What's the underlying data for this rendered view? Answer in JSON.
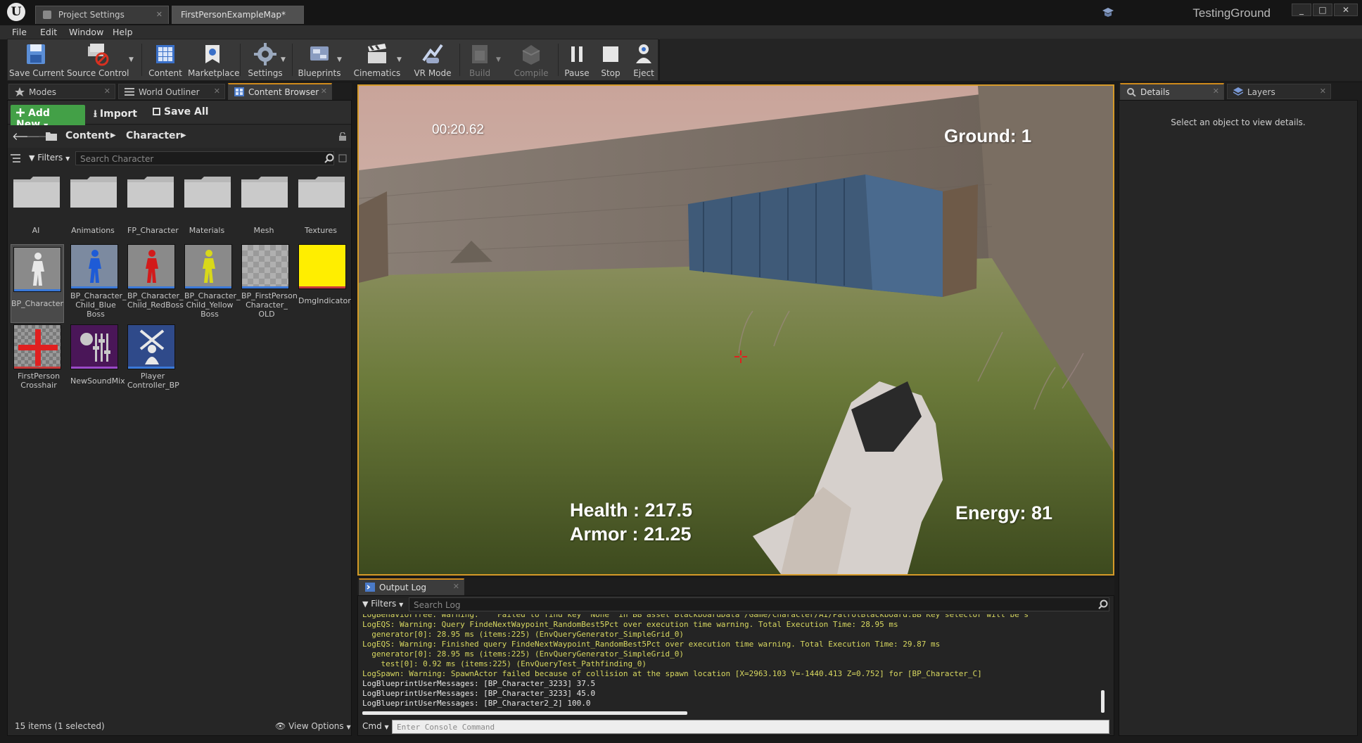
{
  "titlebar": {
    "tabs": [
      {
        "label": "Project Settings"
      },
      {
        "label": "FirstPersonExampleMap*"
      }
    ],
    "project_name": "TestingGround",
    "window_buttons": [
      "_",
      "□",
      "✕"
    ]
  },
  "menu": [
    "File",
    "Edit",
    "Window",
    "Help"
  ],
  "toolbar": {
    "buttons": [
      {
        "label": "Save Current",
        "icon": "save-icon"
      },
      {
        "label": "Source Control",
        "icon": "source-control-icon"
      },
      {
        "label": "Content",
        "icon": "content-icon"
      },
      {
        "label": "Marketplace",
        "icon": "marketplace-icon"
      },
      {
        "label": "Settings",
        "icon": "settings-icon"
      },
      {
        "label": "Blueprints",
        "icon": "blueprints-icon"
      },
      {
        "label": "Cinematics",
        "icon": "cinematics-icon"
      },
      {
        "label": "VR Mode",
        "icon": "vr-mode-icon"
      },
      {
        "label": "Build",
        "icon": "build-icon",
        "disabled": true
      },
      {
        "label": "Compile",
        "icon": "compile-icon",
        "disabled": true
      },
      {
        "label": "Pause",
        "icon": "pause-icon"
      },
      {
        "label": "Stop",
        "icon": "stop-icon"
      },
      {
        "label": "Eject",
        "icon": "eject-icon"
      }
    ]
  },
  "left_tabs": [
    {
      "label": "Modes"
    },
    {
      "label": "World Outliner"
    },
    {
      "label": "Content Browser"
    }
  ],
  "content_browser": {
    "add_new": "Add New",
    "import": "Import",
    "save_all": "Save All",
    "path": [
      "Content",
      "Character"
    ],
    "filters": "Filters",
    "search_placeholder": "Search Character",
    "folders": [
      "AI",
      "Animations",
      "FP_Character",
      "Materials",
      "Mesh",
      "Textures"
    ],
    "assets": [
      {
        "label": "BP_Character",
        "color": "#cfcfcf",
        "selected": true
      },
      {
        "label": "BP_Character_ Child_Blue Boss",
        "color": "#1e5bd6"
      },
      {
        "label": "BP_Character_ Child_RedBoss",
        "color": "#d21a1a"
      },
      {
        "label": "BP_Character_ Child_Yellow Boss",
        "color": "#d8d81a"
      },
      {
        "label": "BP_FirstPerson Character_ OLD",
        "color": "#bdbdbd"
      },
      {
        "label": "DmgIndicator",
        "color": "#ffee00"
      },
      {
        "label": "FirstPerson Crosshair",
        "color": "#e02020"
      },
      {
        "label": "NewSoundMix",
        "color": "#5a1a6a"
      },
      {
        "label": "Player Controller_BP",
        "color": "#2f4a8a"
      }
    ],
    "status": "15 items (1 selected)",
    "view_options": "View Options"
  },
  "viewport": {
    "timer": "00:20.62",
    "ground": "Ground: 1",
    "health": "Health : 217.5",
    "armor": "Armor : 21.25",
    "energy": "Energy: 81"
  },
  "details": {
    "tabs": [
      {
        "label": "Details"
      },
      {
        "label": "Layers"
      }
    ],
    "empty_text": "Select an object to view details."
  },
  "output_log": {
    "tab": "Output Log",
    "filters": "Filters",
    "search_placeholder": "Search Log",
    "lines": [
      {
        "text": "LogBehaviorTree: Warning:    Failed to find key 'None' in BB asset BlackboardData /Game/Character/AI/PatrolBlackboard.BB Key selector will be s",
        "color": "#d8d860"
      },
      {
        "text": "LogEQS: Warning: Query FindeNextWaypoint_RandomBest5Pct over execution time warning. Total Execution Time: 28.95 ms",
        "color": "#d8d860"
      },
      {
        "text": "  generator[0]: 28.95 ms (items:225) (EnvQueryGenerator_SimpleGrid_0)",
        "color": "#d8d860"
      },
      {
        "text": "LogEQS: Warning: Finished query FindeNextWaypoint_RandomBest5Pct over execution time warning. Total Execution Time: 29.87 ms",
        "color": "#d8d860"
      },
      {
        "text": "  generator[0]: 28.95 ms (items:225) (EnvQueryGenerator_SimpleGrid_0)",
        "color": "#d8d860"
      },
      {
        "text": "    test[0]: 0.92 ms (items:225) (EnvQueryTest_Pathfinding_0)",
        "color": "#d8d860"
      },
      {
        "text": "LogSpawn: Warning: SpawnActor failed because of collision at the spawn location [X=2963.103 Y=-1440.413 Z=0.752] for [BP_Character_C]",
        "color": "#d8d860"
      },
      {
        "text": "LogBlueprintUserMessages: [BP_Character_3233] 37.5",
        "color": "#e6e6e6"
      },
      {
        "text": "LogBlueprintUserMessages: [BP_Character_3233] 45.0",
        "color": "#e6e6e6"
      },
      {
        "text": "LogBlueprintUserMessages: [BP_Character2_2] 100.0",
        "color": "#e6e6e6"
      }
    ],
    "cmd_label": "Cmd",
    "cmd_placeholder": "Enter Console Command"
  }
}
